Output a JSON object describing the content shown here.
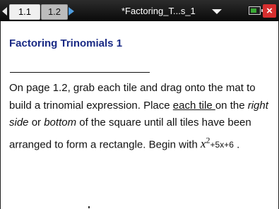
{
  "topbar": {
    "tabs": [
      {
        "label": "1.1"
      },
      {
        "label": "1.2"
      }
    ],
    "doc_title": "*Factoring_T...s_1",
    "colors": {
      "bar": "#111111",
      "active_arrow": "#4f9de0",
      "close": "#d62f2f"
    }
  },
  "document": {
    "heading": "Factoring Trinomials 1",
    "paragraph": {
      "part1": "On page 1.2, grab each tile and drag onto the mat to build a trinomial expression. Place ",
      "underlined": "each tile ",
      "part2": "on the ",
      "italic1": "right side",
      "part3": " or ",
      "italic2": "bottom",
      "part4": " of the square until all tiles have been arranged to form a rectangle. Begin with ",
      "math": {
        "var": "x",
        "exponent": "2",
        "rest": "+5x+6"
      },
      "end": " ."
    },
    "heading_color": "#1a2a85"
  }
}
